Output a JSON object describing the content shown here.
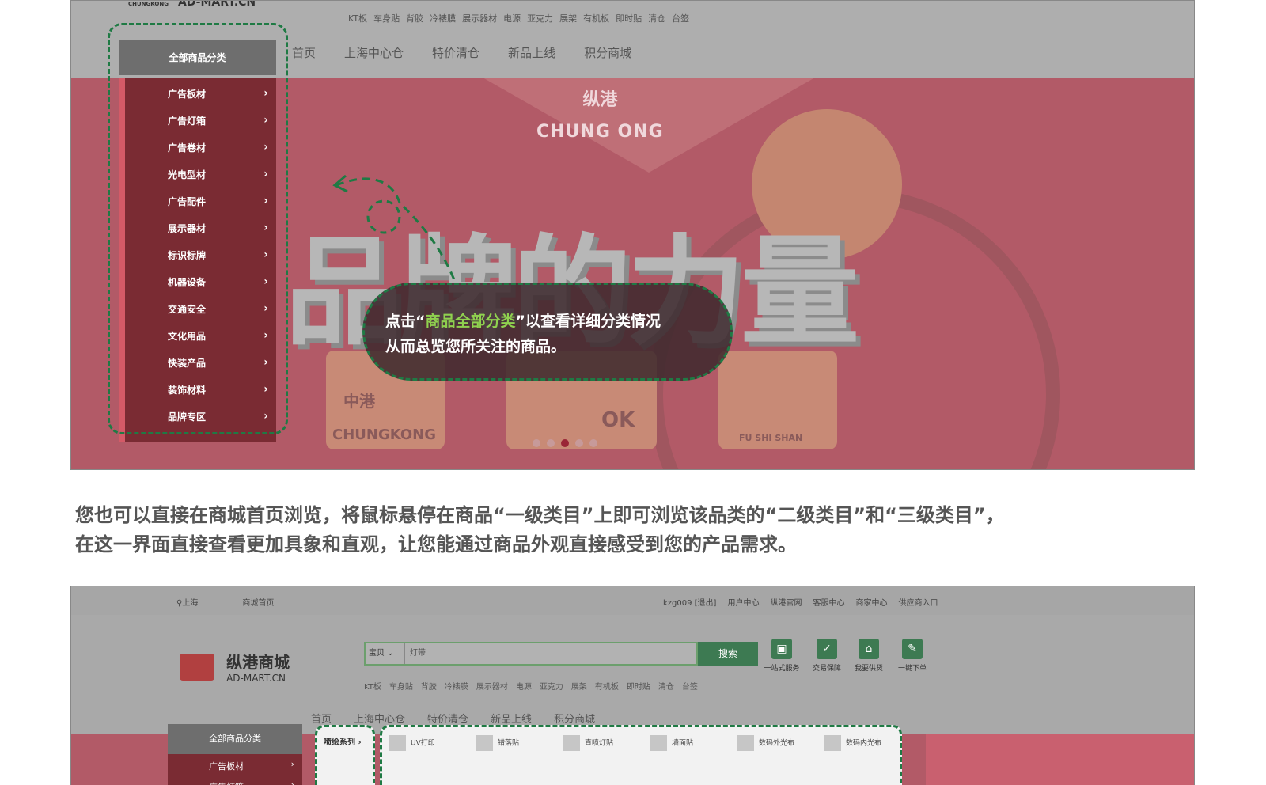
{
  "shot1": {
    "logo": {
      "small": "CHUNGKONG",
      "domain": "AD-MART.CN"
    },
    "hot_words": [
      "KT板",
      "车身贴",
      "背胶",
      "冷裱膜",
      "展示器材",
      "电源",
      "亚克力",
      "展架",
      "有机板",
      "即时贴",
      "清仓",
      "台签"
    ],
    "nav": [
      "首页",
      "上海中心仓",
      "特价清仓",
      "新品上线",
      "积分商城"
    ],
    "banner": {
      "brand_cn": "纵港",
      "brand_en": "CHUNG  ONG",
      "slogan": "品牌的力量",
      "tiles": [
        {
          "cn": "中港",
          "en": "CHUNGKONG"
        },
        {
          "cn": "",
          "en": "OK"
        },
        {
          "cn": "",
          "en": "FU SHI SHAN"
        }
      ],
      "dots": 5,
      "active_dot": 2
    },
    "sidebar": {
      "head": "全部商品分类",
      "items": [
        "广告板材",
        "广告灯箱",
        "广告卷材",
        "光电型材",
        "广告配件",
        "展示器材",
        "标识标牌",
        "机器设备",
        "交通安全",
        "文化用品",
        "快装产品",
        "装饰材料",
        "品牌专区"
      ],
      "chevron": "›"
    },
    "callout": {
      "prefix": "点击“",
      "highlight": "商品全部分类",
      "suffix": "”以查看详细分类情况",
      "line2": "从而总览您所关注的商品。"
    },
    "colors": {
      "accent_green": "#1f7a44",
      "highlight_green": "#8fd14f",
      "sidebar": "#7a2b33"
    }
  },
  "instruction": {
    "line1": "您也可以直接在商城首页浏览，将鼠标悬停在商品“一级类目”上即可浏览该品类的“二级类目”和“三级类目”，",
    "line2": "在这一界面直接查看更加具象和直观，让您能通过商品外观直接感受到您的产品需求。"
  },
  "shot2": {
    "location": [
      "上海",
      "商城首页"
    ],
    "top_links": [
      "kzg009 [退出]",
      "用户中心",
      "纵港官网",
      "客服中心",
      "商家中心",
      "供应商入口"
    ],
    "logo": {
      "cn": "纵港商城",
      "en": "AD-MART.CN"
    },
    "search": {
      "select": "宝贝",
      "placeholder": "灯带",
      "button": "搜索"
    },
    "hot_words": [
      "KT板",
      "车身贴",
      "背胶",
      "冷裱膜",
      "展示器材",
      "电源",
      "亚克力",
      "展架",
      "有机板",
      "即时贴",
      "清仓",
      "台签"
    ],
    "services": [
      "一站式服务",
      "交易保障",
      "我要供货",
      "一键下单"
    ],
    "nav": [
      "首页",
      "上海中心仓",
      "特价清仓",
      "新品上线",
      "积分商城"
    ],
    "category": {
      "head": "全部商品分类",
      "items": [
        "广告板材",
        "广告灯箱"
      ]
    },
    "sub_category": "喷绘系列",
    "products": [
      "UV打印",
      "错落贴",
      "直喷灯贴",
      "墙面贴",
      "数码外光布",
      "数码内光布"
    ]
  }
}
